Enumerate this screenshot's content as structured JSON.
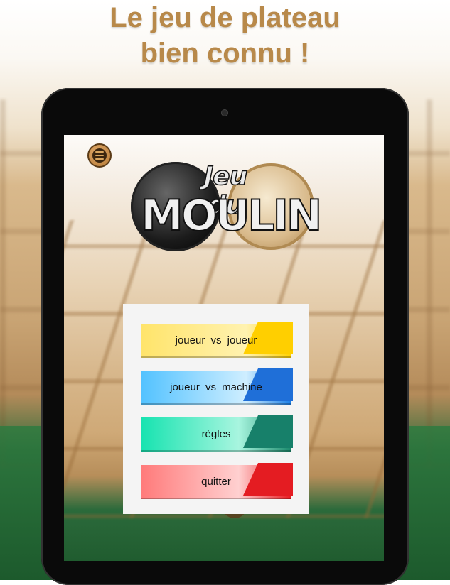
{
  "headline": {
    "line1": "Le jeu de plateau",
    "line2": "bien connu !"
  },
  "logo": {
    "line1": "Jeu du",
    "line2": "MOULIN"
  },
  "menu": {
    "icon": "hamburger-menu-icon",
    "buttons": [
      {
        "label": "joueur vs joueur",
        "color": "#ffd100"
      },
      {
        "label": "joueur vs machine",
        "color": "#1a7fe8"
      },
      {
        "label": "règles",
        "color": "#17806a"
      },
      {
        "label": "quitter",
        "color": "#e41c22"
      }
    ]
  },
  "colors": {
    "headline": "#b8894a",
    "panel": "#f4f4f4",
    "table_green": "#1f5a2e"
  }
}
